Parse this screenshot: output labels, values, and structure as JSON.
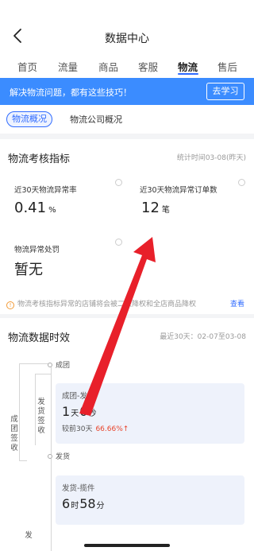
{
  "header": {
    "title": "数据中心"
  },
  "tabs": [
    {
      "label": "首页"
    },
    {
      "label": "流量"
    },
    {
      "label": "商品"
    },
    {
      "label": "客服"
    },
    {
      "label": "物流"
    },
    {
      "label": "售后"
    }
  ],
  "banner": {
    "text": "解决物流问题，都有这些技巧！",
    "button": "去学习"
  },
  "subtabs": {
    "active": "物流概况",
    "other": "物流公司概况"
  },
  "assessment": {
    "title": "物流考核指标",
    "stat_time": "统计时间03-08(昨天)",
    "metrics": [
      {
        "label": "近30天物流异常率",
        "value": "0.41",
        "unit": "%"
      },
      {
        "label": "近30天物流异常订单数",
        "value": "12",
        "unit": "笔"
      },
      {
        "label": "物流异常处罚",
        "value": "暂无",
        "unit": ""
      }
    ],
    "notice": "物流考核指标异常的店铺将会被二级降权和全店商品降权",
    "notice_link": "查看"
  },
  "timeliness": {
    "title": "物流数据时效",
    "range": "最近30天：02-07至03-08",
    "nodes": [
      "成团",
      "发货"
    ],
    "vertical_labels": [
      "成团签收",
      "发货签收",
      "发"
    ],
    "stages": [
      {
        "title": "成团-发货",
        "days": "1",
        "day_unit": "天",
        "hours": "0",
        "hour_unit": "秒",
        "compare_label": "较前30天",
        "compare_value": "66.66%",
        "trend": "↑"
      },
      {
        "title": "发货-揽件",
        "days": "6",
        "day_unit": "时",
        "hours": "58",
        "hour_unit": "分"
      }
    ]
  },
  "colors": {
    "accent": "#2f6bff",
    "banner": "#3b8cff",
    "warning": "#e8452c",
    "arrow": "#e8202a"
  },
  "icons": {
    "back": "chevron-left-icon",
    "info": "info-circle-icon",
    "notice": "warning-circle-icon"
  }
}
